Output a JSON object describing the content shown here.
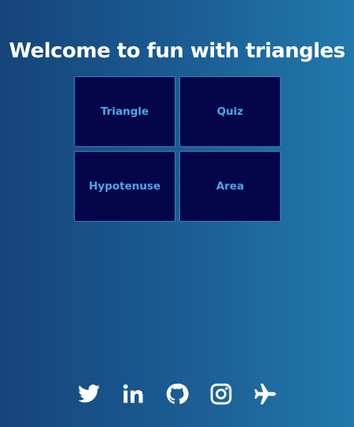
{
  "header": {
    "title": "Welcome to fun with triangles"
  },
  "menu": {
    "items": [
      {
        "label": "Triangle"
      },
      {
        "label": "Quiz"
      },
      {
        "label": "Hypotenuse"
      },
      {
        "label": "Area"
      }
    ]
  },
  "footer": {
    "social": [
      {
        "icon": "twitter-icon"
      },
      {
        "icon": "linkedin-icon"
      },
      {
        "icon": "github-icon"
      },
      {
        "icon": "instagram-icon"
      },
      {
        "icon": "airplane-icon"
      }
    ]
  },
  "colors": {
    "background_start": "#154479",
    "background_end": "#2179ac",
    "tile_background": "#05064a",
    "tile_text": "#4da6e6",
    "title_text": "#ffffff"
  }
}
